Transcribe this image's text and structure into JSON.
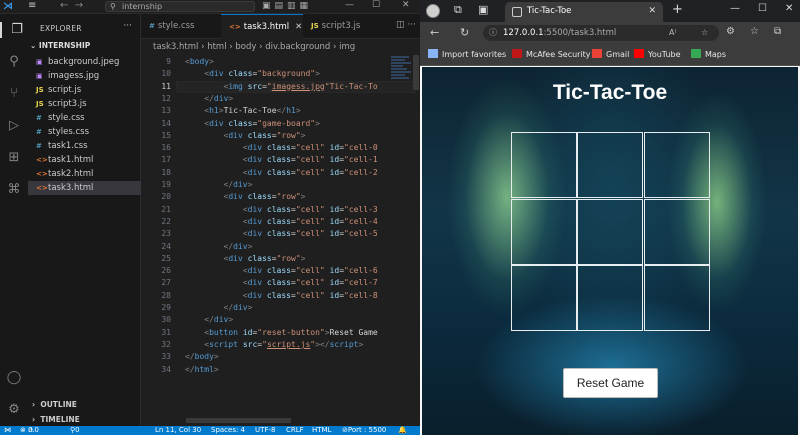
{
  "vscode": {
    "search": "internship",
    "explorer_title": "EXPLORER",
    "root_folder": "INTERNSHIP",
    "files": [
      {
        "name": "background.jpeg",
        "icon": "image-icon",
        "color": "#c08aff",
        "glyph": "▣"
      },
      {
        "name": "imagess.jpg",
        "icon": "image-icon",
        "color": "#c08aff",
        "glyph": "▣"
      },
      {
        "name": "script.js",
        "icon": "js-icon",
        "color": "#e8d44d",
        "glyph": "JS"
      },
      {
        "name": "script3.js",
        "icon": "js-icon",
        "color": "#e8d44d",
        "glyph": "JS"
      },
      {
        "name": "style.css",
        "icon": "css-icon",
        "color": "#519aba",
        "glyph": "#"
      },
      {
        "name": "styles.css",
        "icon": "css-icon",
        "color": "#519aba",
        "glyph": "#"
      },
      {
        "name": "task1.css",
        "icon": "css-icon",
        "color": "#519aba",
        "glyph": "#"
      },
      {
        "name": "task1.html",
        "icon": "html-icon",
        "color": "#e37933",
        "glyph": "<>"
      },
      {
        "name": "task2.html",
        "icon": "html-icon",
        "color": "#e37933",
        "glyph": "<>"
      },
      {
        "name": "task3.html",
        "icon": "html-icon",
        "color": "#e37933",
        "glyph": "<>",
        "selected": true
      }
    ],
    "outline_label": "OUTLINE",
    "timeline_label": "TIMELINE",
    "tabs": [
      {
        "label": "style.css",
        "glyph": "#",
        "color": "#519aba"
      },
      {
        "label": "task3.html",
        "glyph": "<>",
        "color": "#e37933"
      },
      {
        "label": "script3.js",
        "glyph": "JS",
        "color": "#e8d44d"
      }
    ],
    "breadcrumb": [
      "task3.html",
      "html",
      "body",
      "div.background",
      "img"
    ],
    "code_lines": [
      {
        "n": 9,
        "html": "<span class='pu'>&lt;</span><span class='tg'>body</span><span class='pu'>&gt;</span>"
      },
      {
        "n": 10,
        "html": "    <span class='pu'>&lt;</span><span class='tg'>div</span> <span class='at'>class</span>=<span class='st'>\"background\"</span><span class='pu'>&gt;</span>"
      },
      {
        "n": 11,
        "html": "        <span class='pu'>&lt;</span><span class='tg'>img</span> <span class='at'>src</span>=<span class='st'>\"<u>imagess.jpg</u>\"</span><span class='st'>Tic-Tac-To</span>"
      },
      {
        "n": 12,
        "html": "    <span class='pu'>&lt;/</span><span class='tg'>div</span><span class='pu'>&gt;</span>"
      },
      {
        "n": 13,
        "html": "    <span class='pu'>&lt;</span><span class='tg'>h1</span><span class='pu'>&gt;</span><span class='tx'>Tic-Tac-Toe</span><span class='pu'>&lt;/</span><span class='tg'>h1</span><span class='pu'>&gt;</span>"
      },
      {
        "n": 14,
        "html": "    <span class='pu'>&lt;</span><span class='tg'>div</span> <span class='at'>class</span>=<span class='st'>\"game-board\"</span><span class='pu'>&gt;</span>"
      },
      {
        "n": 15,
        "html": "        <span class='pu'>&lt;</span><span class='tg'>div</span> <span class='at'>class</span>=<span class='st'>\"row\"</span><span class='pu'>&gt;</span>"
      },
      {
        "n": 16,
        "html": "            <span class='pu'>&lt;</span><span class='tg'>div</span> <span class='at'>class</span>=<span class='st'>\"cell\"</span> <span class='at'>id</span>=<span class='st'>\"cell-0</span>"
      },
      {
        "n": 17,
        "html": "            <span class='pu'>&lt;</span><span class='tg'>div</span> <span class='at'>class</span>=<span class='st'>\"cell\"</span> <span class='at'>id</span>=<span class='st'>\"cell-1</span>"
      },
      {
        "n": 18,
        "html": "            <span class='pu'>&lt;</span><span class='tg'>div</span> <span class='at'>class</span>=<span class='st'>\"cell\"</span> <span class='at'>id</span>=<span class='st'>\"cell-2</span>"
      },
      {
        "n": 19,
        "html": "        <span class='pu'>&lt;/</span><span class='tg'>div</span><span class='pu'>&gt;</span>"
      },
      {
        "n": 20,
        "html": "        <span class='pu'>&lt;</span><span class='tg'>div</span> <span class='at'>class</span>=<span class='st'>\"row\"</span><span class='pu'>&gt;</span>"
      },
      {
        "n": 21,
        "html": "            <span class='pu'>&lt;</span><span class='tg'>div</span> <span class='at'>class</span>=<span class='st'>\"cell\"</span> <span class='at'>id</span>=<span class='st'>\"cell-3</span>"
      },
      {
        "n": 22,
        "html": "            <span class='pu'>&lt;</span><span class='tg'>div</span> <span class='at'>class</span>=<span class='st'>\"cell\"</span> <span class='at'>id</span>=<span class='st'>\"cell-4</span>"
      },
      {
        "n": 23,
        "html": "            <span class='pu'>&lt;</span><span class='tg'>div</span> <span class='at'>class</span>=<span class='st'>\"cell\"</span> <span class='at'>id</span>=<span class='st'>\"cell-5</span>"
      },
      {
        "n": 24,
        "html": "        <span class='pu'>&lt;/</span><span class='tg'>div</span><span class='pu'>&gt;</span>"
      },
      {
        "n": 25,
        "html": "        <span class='pu'>&lt;</span><span class='tg'>div</span> <span class='at'>class</span>=<span class='st'>\"row\"</span><span class='pu'>&gt;</span>"
      },
      {
        "n": 26,
        "html": "            <span class='pu'>&lt;</span><span class='tg'>div</span> <span class='at'>class</span>=<span class='st'>\"cell\"</span> <span class='at'>id</span>=<span class='st'>\"cell-6</span>"
      },
      {
        "n": 27,
        "html": "            <span class='pu'>&lt;</span><span class='tg'>div</span> <span class='at'>class</span>=<span class='st'>\"cell\"</span> <span class='at'>id</span>=<span class='st'>\"cell-7</span>"
      },
      {
        "n": 28,
        "html": "            <span class='pu'>&lt;</span><span class='tg'>div</span> <span class='at'>class</span>=<span class='st'>\"cell\"</span> <span class='at'>id</span>=<span class='st'>\"cell-8</span>"
      },
      {
        "n": 29,
        "html": "        <span class='pu'>&lt;/</span><span class='tg'>div</span><span class='pu'>&gt;</span>"
      },
      {
        "n": 30,
        "html": "    <span class='pu'>&lt;/</span><span class='tg'>div</span><span class='pu'>&gt;</span>"
      },
      {
        "n": 31,
        "html": "    <span class='pu'>&lt;</span><span class='tg'>button</span> <span class='at'>id</span>=<span class='st'>\"reset-button\"</span><span class='pu'>&gt;</span><span class='tx'>Reset Game</span>"
      },
      {
        "n": 32,
        "html": "    <span class='pu'>&lt;</span><span class='tg'>script</span> <span class='at'>src</span>=<span class='st'>\"<u>script.js</u>\"</span><span class='pu'>&gt;&lt;/</span><span class='tg'>script</span><span class='pu'>&gt;</span>"
      },
      {
        "n": 33,
        "html": "<span class='pu'>&lt;/</span><span class='tg'>body</span><span class='pu'>&gt;</span>"
      },
      {
        "n": 34,
        "html": "<span class='pu'>&lt;/</span><span class='tg'>html</span><span class='pu'>&gt;</span>"
      }
    ],
    "current_line": 11,
    "status": {
      "errors": "0",
      "warnings": "0",
      "ports": "0",
      "position": "Ln 11, Col 30",
      "spaces": "Spaces: 4",
      "encoding": "UTF-8",
      "eol": "CRLF",
      "language": "HTML",
      "port": "Port : 5500"
    }
  },
  "browser": {
    "tab_title": "Tic-Tac-Toe",
    "url_host": "127.0.0.1",
    "url_path": ":5500/task3.html",
    "bookmarks": [
      {
        "label": "Import favorites",
        "icon": "import-icon",
        "color": "#8ab4f8"
      },
      {
        "label": "McAfee Security",
        "icon": "mcafee-icon",
        "color": "#c01818"
      },
      {
        "label": "Gmail",
        "icon": "gmail-icon",
        "color": "#ea4335"
      },
      {
        "label": "YouTube",
        "icon": "youtube-icon",
        "color": "#ff0000"
      },
      {
        "label": "Maps",
        "icon": "maps-icon",
        "color": "#34a853"
      }
    ],
    "page": {
      "title": "Tic-Tac-Toe",
      "cells": [
        "",
        "",
        "",
        "",
        "",
        "",
        "",
        "",
        ""
      ],
      "reset_label": "Reset Game"
    }
  }
}
